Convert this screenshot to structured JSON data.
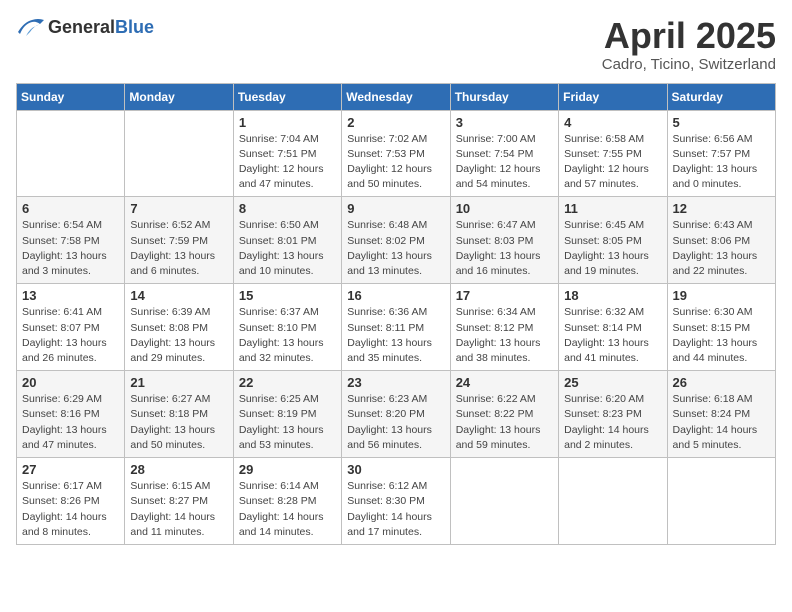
{
  "header": {
    "logo_general": "General",
    "logo_blue": "Blue",
    "month": "April 2025",
    "location": "Cadro, Ticino, Switzerland"
  },
  "weekdays": [
    "Sunday",
    "Monday",
    "Tuesday",
    "Wednesday",
    "Thursday",
    "Friday",
    "Saturday"
  ],
  "weeks": [
    [
      {
        "day": "",
        "detail": ""
      },
      {
        "day": "",
        "detail": ""
      },
      {
        "day": "1",
        "detail": "Sunrise: 7:04 AM\nSunset: 7:51 PM\nDaylight: 12 hours and 47 minutes."
      },
      {
        "day": "2",
        "detail": "Sunrise: 7:02 AM\nSunset: 7:53 PM\nDaylight: 12 hours and 50 minutes."
      },
      {
        "day": "3",
        "detail": "Sunrise: 7:00 AM\nSunset: 7:54 PM\nDaylight: 12 hours and 54 minutes."
      },
      {
        "day": "4",
        "detail": "Sunrise: 6:58 AM\nSunset: 7:55 PM\nDaylight: 12 hours and 57 minutes."
      },
      {
        "day": "5",
        "detail": "Sunrise: 6:56 AM\nSunset: 7:57 PM\nDaylight: 13 hours and 0 minutes."
      }
    ],
    [
      {
        "day": "6",
        "detail": "Sunrise: 6:54 AM\nSunset: 7:58 PM\nDaylight: 13 hours and 3 minutes."
      },
      {
        "day": "7",
        "detail": "Sunrise: 6:52 AM\nSunset: 7:59 PM\nDaylight: 13 hours and 6 minutes."
      },
      {
        "day": "8",
        "detail": "Sunrise: 6:50 AM\nSunset: 8:01 PM\nDaylight: 13 hours and 10 minutes."
      },
      {
        "day": "9",
        "detail": "Sunrise: 6:48 AM\nSunset: 8:02 PM\nDaylight: 13 hours and 13 minutes."
      },
      {
        "day": "10",
        "detail": "Sunrise: 6:47 AM\nSunset: 8:03 PM\nDaylight: 13 hours and 16 minutes."
      },
      {
        "day": "11",
        "detail": "Sunrise: 6:45 AM\nSunset: 8:05 PM\nDaylight: 13 hours and 19 minutes."
      },
      {
        "day": "12",
        "detail": "Sunrise: 6:43 AM\nSunset: 8:06 PM\nDaylight: 13 hours and 22 minutes."
      }
    ],
    [
      {
        "day": "13",
        "detail": "Sunrise: 6:41 AM\nSunset: 8:07 PM\nDaylight: 13 hours and 26 minutes."
      },
      {
        "day": "14",
        "detail": "Sunrise: 6:39 AM\nSunset: 8:08 PM\nDaylight: 13 hours and 29 minutes."
      },
      {
        "day": "15",
        "detail": "Sunrise: 6:37 AM\nSunset: 8:10 PM\nDaylight: 13 hours and 32 minutes."
      },
      {
        "day": "16",
        "detail": "Sunrise: 6:36 AM\nSunset: 8:11 PM\nDaylight: 13 hours and 35 minutes."
      },
      {
        "day": "17",
        "detail": "Sunrise: 6:34 AM\nSunset: 8:12 PM\nDaylight: 13 hours and 38 minutes."
      },
      {
        "day": "18",
        "detail": "Sunrise: 6:32 AM\nSunset: 8:14 PM\nDaylight: 13 hours and 41 minutes."
      },
      {
        "day": "19",
        "detail": "Sunrise: 6:30 AM\nSunset: 8:15 PM\nDaylight: 13 hours and 44 minutes."
      }
    ],
    [
      {
        "day": "20",
        "detail": "Sunrise: 6:29 AM\nSunset: 8:16 PM\nDaylight: 13 hours and 47 minutes."
      },
      {
        "day": "21",
        "detail": "Sunrise: 6:27 AM\nSunset: 8:18 PM\nDaylight: 13 hours and 50 minutes."
      },
      {
        "day": "22",
        "detail": "Sunrise: 6:25 AM\nSunset: 8:19 PM\nDaylight: 13 hours and 53 minutes."
      },
      {
        "day": "23",
        "detail": "Sunrise: 6:23 AM\nSunset: 8:20 PM\nDaylight: 13 hours and 56 minutes."
      },
      {
        "day": "24",
        "detail": "Sunrise: 6:22 AM\nSunset: 8:22 PM\nDaylight: 13 hours and 59 minutes."
      },
      {
        "day": "25",
        "detail": "Sunrise: 6:20 AM\nSunset: 8:23 PM\nDaylight: 14 hours and 2 minutes."
      },
      {
        "day": "26",
        "detail": "Sunrise: 6:18 AM\nSunset: 8:24 PM\nDaylight: 14 hours and 5 minutes."
      }
    ],
    [
      {
        "day": "27",
        "detail": "Sunrise: 6:17 AM\nSunset: 8:26 PM\nDaylight: 14 hours and 8 minutes."
      },
      {
        "day": "28",
        "detail": "Sunrise: 6:15 AM\nSunset: 8:27 PM\nDaylight: 14 hours and 11 minutes."
      },
      {
        "day": "29",
        "detail": "Sunrise: 6:14 AM\nSunset: 8:28 PM\nDaylight: 14 hours and 14 minutes."
      },
      {
        "day": "30",
        "detail": "Sunrise: 6:12 AM\nSunset: 8:30 PM\nDaylight: 14 hours and 17 minutes."
      },
      {
        "day": "",
        "detail": ""
      },
      {
        "day": "",
        "detail": ""
      },
      {
        "day": "",
        "detail": ""
      }
    ]
  ]
}
